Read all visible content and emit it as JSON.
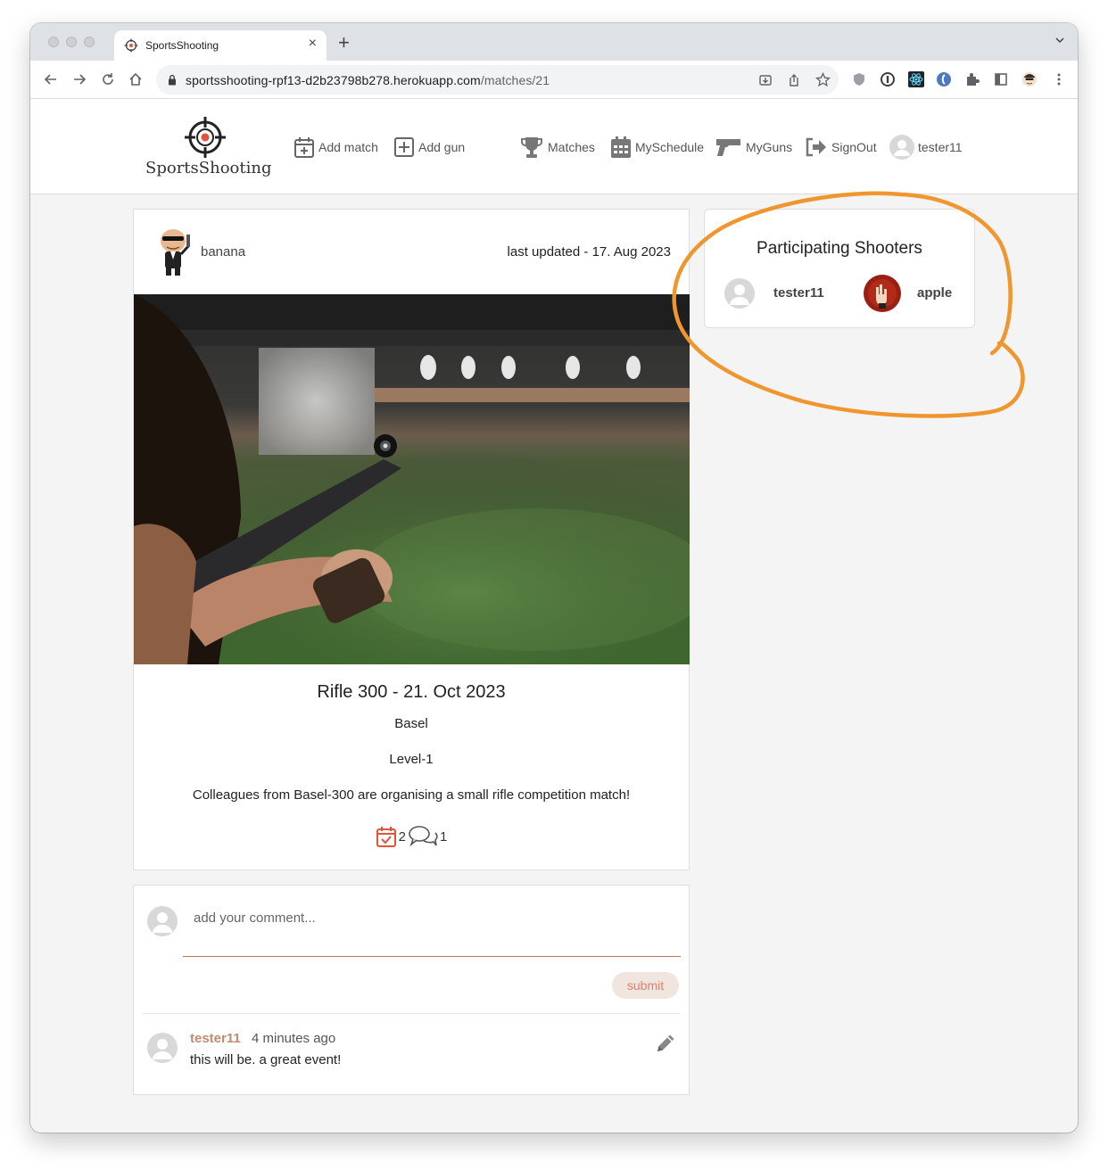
{
  "browser": {
    "tab_title": "SportsShooting",
    "tab_close": "×",
    "new_tab": "+",
    "url_domain": "sportsshooting-rpf13-d2b23798b278.herokuapp.com",
    "url_path": "/matches/21"
  },
  "site": {
    "logo_text": "SportsShooting",
    "nav": {
      "add_match": "Add match",
      "add_gun": "Add gun",
      "matches": "Matches",
      "my_schedule": "MySchedule",
      "my_guns": "MyGuns",
      "sign_out": "SignOut",
      "profile": "tester11"
    }
  },
  "post": {
    "author": "banana",
    "updated": "last updated - 17. Aug 2023",
    "title": "Rifle 300 - 21. Oct 2023",
    "location": "Basel",
    "level": "Level-1",
    "description": "Colleagues from Basel-300 are organising a small rifle competition match!",
    "attendee_count": "2",
    "comment_count": "1"
  },
  "shooters": {
    "title": "Participating Shooters",
    "list": [
      {
        "name": "tester11"
      },
      {
        "name": "apple"
      }
    ]
  },
  "comment_form": {
    "placeholder": "add your comment...",
    "submit_label": "submit"
  },
  "comments": [
    {
      "author": "tester11",
      "time": "4 minutes ago",
      "text": "this will be. a great event!"
    }
  ],
  "colors": {
    "accent": "#e2533a",
    "annotation": "#f0962e",
    "comment_author": "#c38a6f"
  }
}
